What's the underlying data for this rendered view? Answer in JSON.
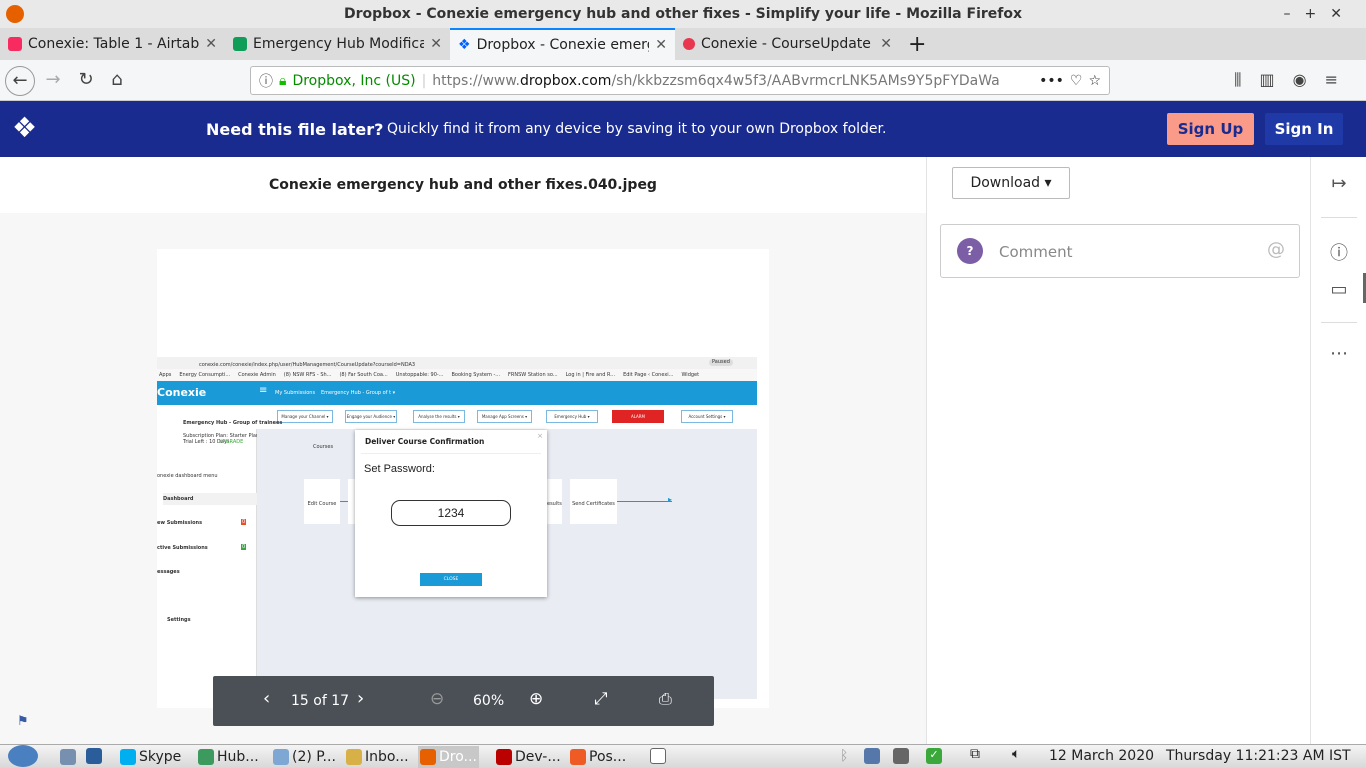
{
  "window": {
    "title": "Dropbox - Conexie emergency hub and other fixes - Simplify your life - Mozilla Firefox",
    "controls": [
      "–",
      "+",
      "✕"
    ]
  },
  "tabs": [
    {
      "label": "Conexie: Table 1 - Airtable",
      "icon": "airtable-icon",
      "color": "#f82b60"
    },
    {
      "label": "Emergency Hub Modifications",
      "icon": "sheets-icon",
      "color": "#0f9d58"
    },
    {
      "label": "Dropbox - Conexie emergency",
      "icon": "dropbox-icon",
      "color": "#0061ff",
      "active": true
    },
    {
      "label": "Conexie - CourseUpdate",
      "icon": "conexie-icon",
      "color": "#e8384f"
    }
  ],
  "nav": {
    "identity": "Dropbox, Inc (US)",
    "url_prefix": "https://www.",
    "url_domain": "dropbox.com",
    "url_rest": "/sh/kkbzzsm6qx4w5f3/AABvrmcrLNK5AMs9Y5pFYDaWa",
    "more": "•••"
  },
  "banner": {
    "headline": "Need this file later?",
    "text": "Quickly find it from any device by saving it to your own Dropbox folder.",
    "signup": "Sign Up",
    "signin": "Sign In",
    "colors": {
      "bg": "#1a2b8f",
      "signup": "#fa9b8a",
      "signin": "#1f3aa6"
    }
  },
  "file": {
    "name": "Conexie emergency hub and other fixes.040.jpeg"
  },
  "panel": {
    "download": "Download",
    "comment_placeholder": "Comment",
    "avatar": "?"
  },
  "viewer": {
    "page": "15 of 17",
    "zoom": "60%"
  },
  "shot": {
    "url": "conexie.com/conexie/index.php/user/HubManagement/CourseUpdate?courseId=NDA3",
    "paused": "Paused",
    "bookmarks": [
      "Apps",
      "Energy Consumpti...",
      "Conexie Admin",
      "(8) NSW RFS - Sh...",
      "(8) Far South Coa...",
      "Unstoppable: 90-...",
      "Booking System -...",
      "FRNSW Station so...",
      "Log in | Fire and R...",
      "Edit Page ‹ Conexi...",
      "Widget"
    ],
    "logo": "Conexie",
    "nav1": "My Submissions",
    "nav2": "Emergency Hub - Group of t ▾",
    "menus": [
      "Manage your Channel ▾",
      "Engage your Audience ▾",
      "Analyse the results ▾",
      "Manage App Screens ▾",
      "Emergency Hub ▾",
      "ALARM",
      "Account Settings ▾"
    ],
    "org": "Emergency Hub - Group of trainees",
    "plan": "Subscription Plan: Starter Plan",
    "trial": "Trial Left : 10 Days",
    "upgrade": "UPGRADE",
    "menu_label": "onexie dashboard menu",
    "side": [
      "Dashboard",
      "ew Submissions",
      "ctive Submissions",
      "essages",
      "Settings"
    ],
    "badge1": "0",
    "badge2": "0",
    "courses": "Courses",
    "step1": "Edit Course",
    "step2": "esults",
    "step3": "Send Certificates",
    "modal": {
      "title": "Deliver Course Confirmation",
      "label": "Set Password:",
      "value": "1234",
      "close": "CLOSE",
      "x": "×"
    }
  },
  "taskbar": {
    "items": [
      {
        "label": "Skype",
        "color": "#00aff0"
      },
      {
        "label": "Hub...",
        "color": "#3c9a5f"
      },
      {
        "label": "(2) P...",
        "color": "#7fa7d4"
      },
      {
        "label": "Inbo...",
        "color": "#d8b048"
      },
      {
        "label": "Dro...",
        "color": "#e66000",
        "active": true
      },
      {
        "label": "Dev-...",
        "color": "#b00"
      },
      {
        "label": "Pos...",
        "color": "#ef5b25"
      }
    ],
    "date": "12 March 2020",
    "time": "Thursday 11:21:23 AM IST"
  }
}
